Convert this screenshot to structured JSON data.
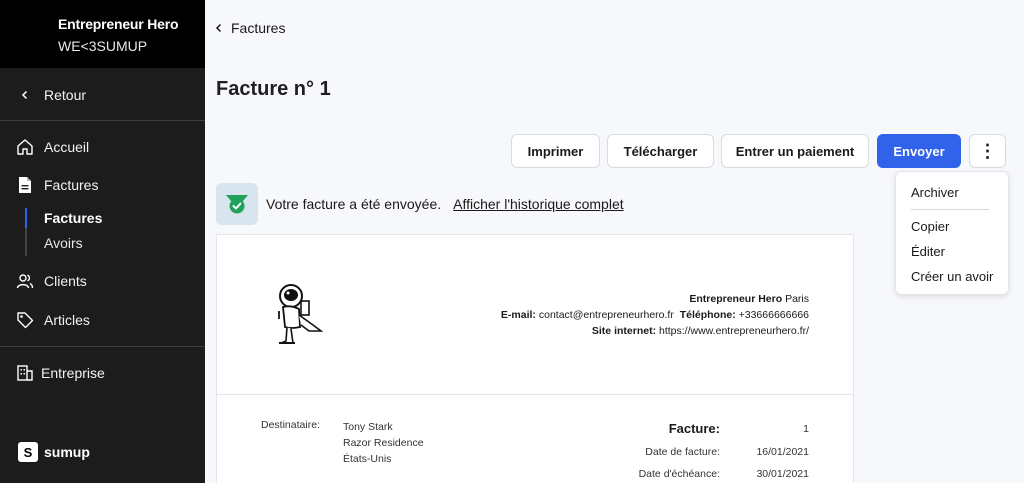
{
  "sidebar": {
    "org_name": "Entrepreneur Hero",
    "org_sub": "WE<3SUMUP",
    "back_label": "Retour",
    "items": [
      {
        "label": "Accueil",
        "icon": "home-icon"
      },
      {
        "label": "Factures",
        "icon": "document-icon"
      },
      {
        "label": "Clients",
        "icon": "users-icon"
      },
      {
        "label": "Articles",
        "icon": "tag-icon"
      },
      {
        "label": "Entreprise",
        "icon": "building-icon"
      }
    ],
    "sub_items": [
      {
        "label": "Factures",
        "active": true
      },
      {
        "label": "Avoirs",
        "active": false
      }
    ],
    "brand": "sumup"
  },
  "breadcrumb": "Factures",
  "page_title": "Facture n° 1",
  "actions": {
    "print": "Imprimer",
    "download": "Télécharger",
    "payment": "Entrer un paiement",
    "send": "Envoyer",
    "more": "⋮"
  },
  "menu": {
    "items": [
      "Archiver",
      "Copier",
      "Éditer",
      "Créer un avoir"
    ]
  },
  "notice": {
    "text": "Votre facture a été envoyée.",
    "link": "Afficher l'historique complet"
  },
  "invoice": {
    "company_name": "Entrepreneur Hero",
    "company_city": "Paris",
    "email_label": "E-mail:",
    "email": "contact@entrepreneurhero.fr",
    "phone_label": "Téléphone:",
    "phone": "+33666666666",
    "site_label": "Site internet:",
    "site": "https://www.entrepreneurhero.fr/",
    "dest_label": "Destinataire:",
    "dest_lines": [
      "Tony Stark",
      "Razor Residence",
      "États-Unis"
    ],
    "invoice_label": "Facture:",
    "invoice_number": "1",
    "date_label": "Date de facture:",
    "date": "16/01/2021",
    "due_label": "Date d'échéance:",
    "due": "30/01/2021"
  },
  "colors": {
    "primary": "#3063e9",
    "sidebar_bg": "#1c1c1c",
    "success": "#1fa35a"
  }
}
